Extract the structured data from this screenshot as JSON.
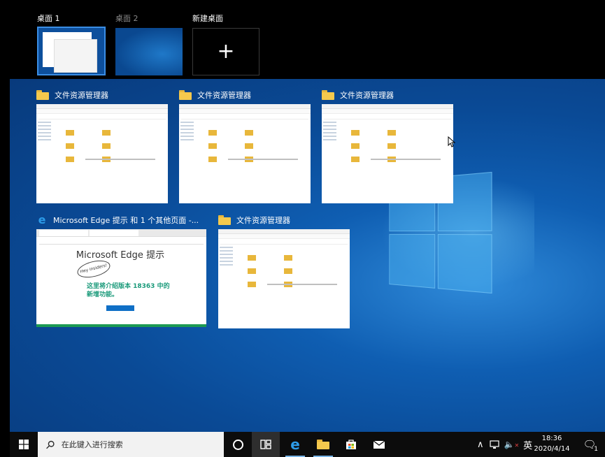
{
  "desktops": [
    {
      "label": "桌面 1",
      "active": true
    },
    {
      "label": "桌面 2",
      "active": false
    },
    {
      "label": "新建桌面"
    }
  ],
  "windows": [
    {
      "title": "文件资源管理器",
      "icon": "folder-icon",
      "kind": "explorer"
    },
    {
      "title": "文件资源管理器",
      "icon": "folder-icon",
      "kind": "explorer"
    },
    {
      "title": "文件资源管理器",
      "icon": "folder-icon",
      "kind": "explorer"
    },
    {
      "title": "Microsoft Edge 提示 和 1 个其他页面 -...",
      "icon": "edge-icon",
      "kind": "edge",
      "page_heading": "Microsoft Edge 提示",
      "page_subtitle": "这里将介绍版本 18363 中的新增功能。",
      "badge": "Hey insiders!"
    },
    {
      "title": "文件资源管理器",
      "icon": "folder-icon",
      "kind": "explorer"
    }
  ],
  "taskbar": {
    "search_placeholder": "在此键入进行搜索",
    "ime": "英",
    "time": "18:36",
    "date": "2020/4/14",
    "notification_count": "1"
  },
  "colors": {
    "accent": "#3a8ee6",
    "taskbar": "#0c0c0c",
    "desktop": "#0a4a96"
  }
}
